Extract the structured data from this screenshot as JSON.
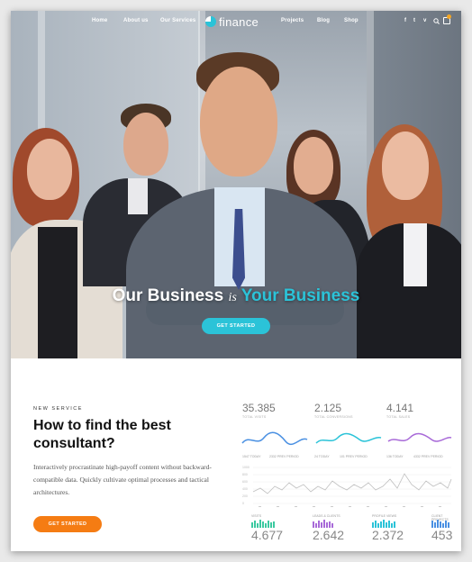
{
  "nav": {
    "links_left": [
      "Home",
      "About us",
      "Our Services"
    ],
    "logo_text": "finance",
    "links_right": [
      "Projects",
      "Blog",
      "Shop"
    ],
    "social": [
      "f",
      "t",
      "v"
    ]
  },
  "hero": {
    "headline_part1": "Our Business",
    "headline_is": "is",
    "headline_part2": "Your Business",
    "cta_label": "GET STARTED"
  },
  "content": {
    "kicker": "NEW SERVICE",
    "title": "How to find the best consultant?",
    "description": "Interactively procrastinate high-payoff content without backward-compatible data. Quickly cultivate optimal processes and tactical architectures.",
    "cta_label": "GET STARTED"
  },
  "dashboard": {
    "stats": [
      {
        "value": "35.385",
        "label": "TOTAL VISITS"
      },
      {
        "value": "2.125",
        "label": "TOTAL CONVERSIONS"
      },
      {
        "value": "4.141",
        "label": "TOTAL SALES"
      }
    ],
    "legend": [
      "1547 TODAY",
      "2332 PREV PERIOD",
      "24 TODAY",
      "101 PREV PERIOD",
      "136 TODAY",
      "4332 PREV PERIOD"
    ],
    "y_ticks": [
      "1000",
      "800",
      "600",
      "400",
      "200",
      "0"
    ],
    "bottom": [
      {
        "label": "VISITS",
        "value": "4.677"
      },
      {
        "label": "LEADS & CLIENTS",
        "value": "2.642"
      },
      {
        "label": "PROFILE VIEWS",
        "value": "2.372"
      },
      {
        "label": "CLIENT PROJECTS",
        "value": "453"
      }
    ],
    "colors": {
      "blue": "#4a90e2",
      "teal": "#2bc3d8",
      "purple": "#a86ad8",
      "green": "#3cc9a0"
    }
  }
}
